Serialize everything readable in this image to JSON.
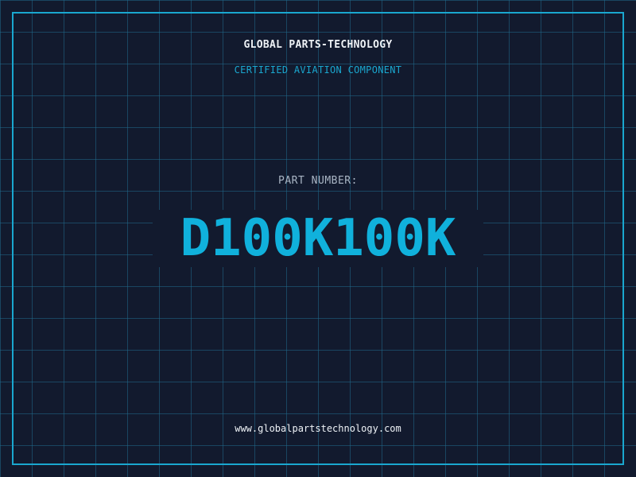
{
  "header": {
    "brand": "GLOBAL PARTS-TECHNOLOGY",
    "tagline": "CERTIFIED AVIATION COMPONENT"
  },
  "part": {
    "label": "PART NUMBER:",
    "number": "D100K100K"
  },
  "footer": {
    "url": "www.globalpartstechnology.com"
  },
  "colors": {
    "background": "#121a2e",
    "grid": "#20698a",
    "accent": "#1aa7cf",
    "text": "#eef2f6"
  }
}
